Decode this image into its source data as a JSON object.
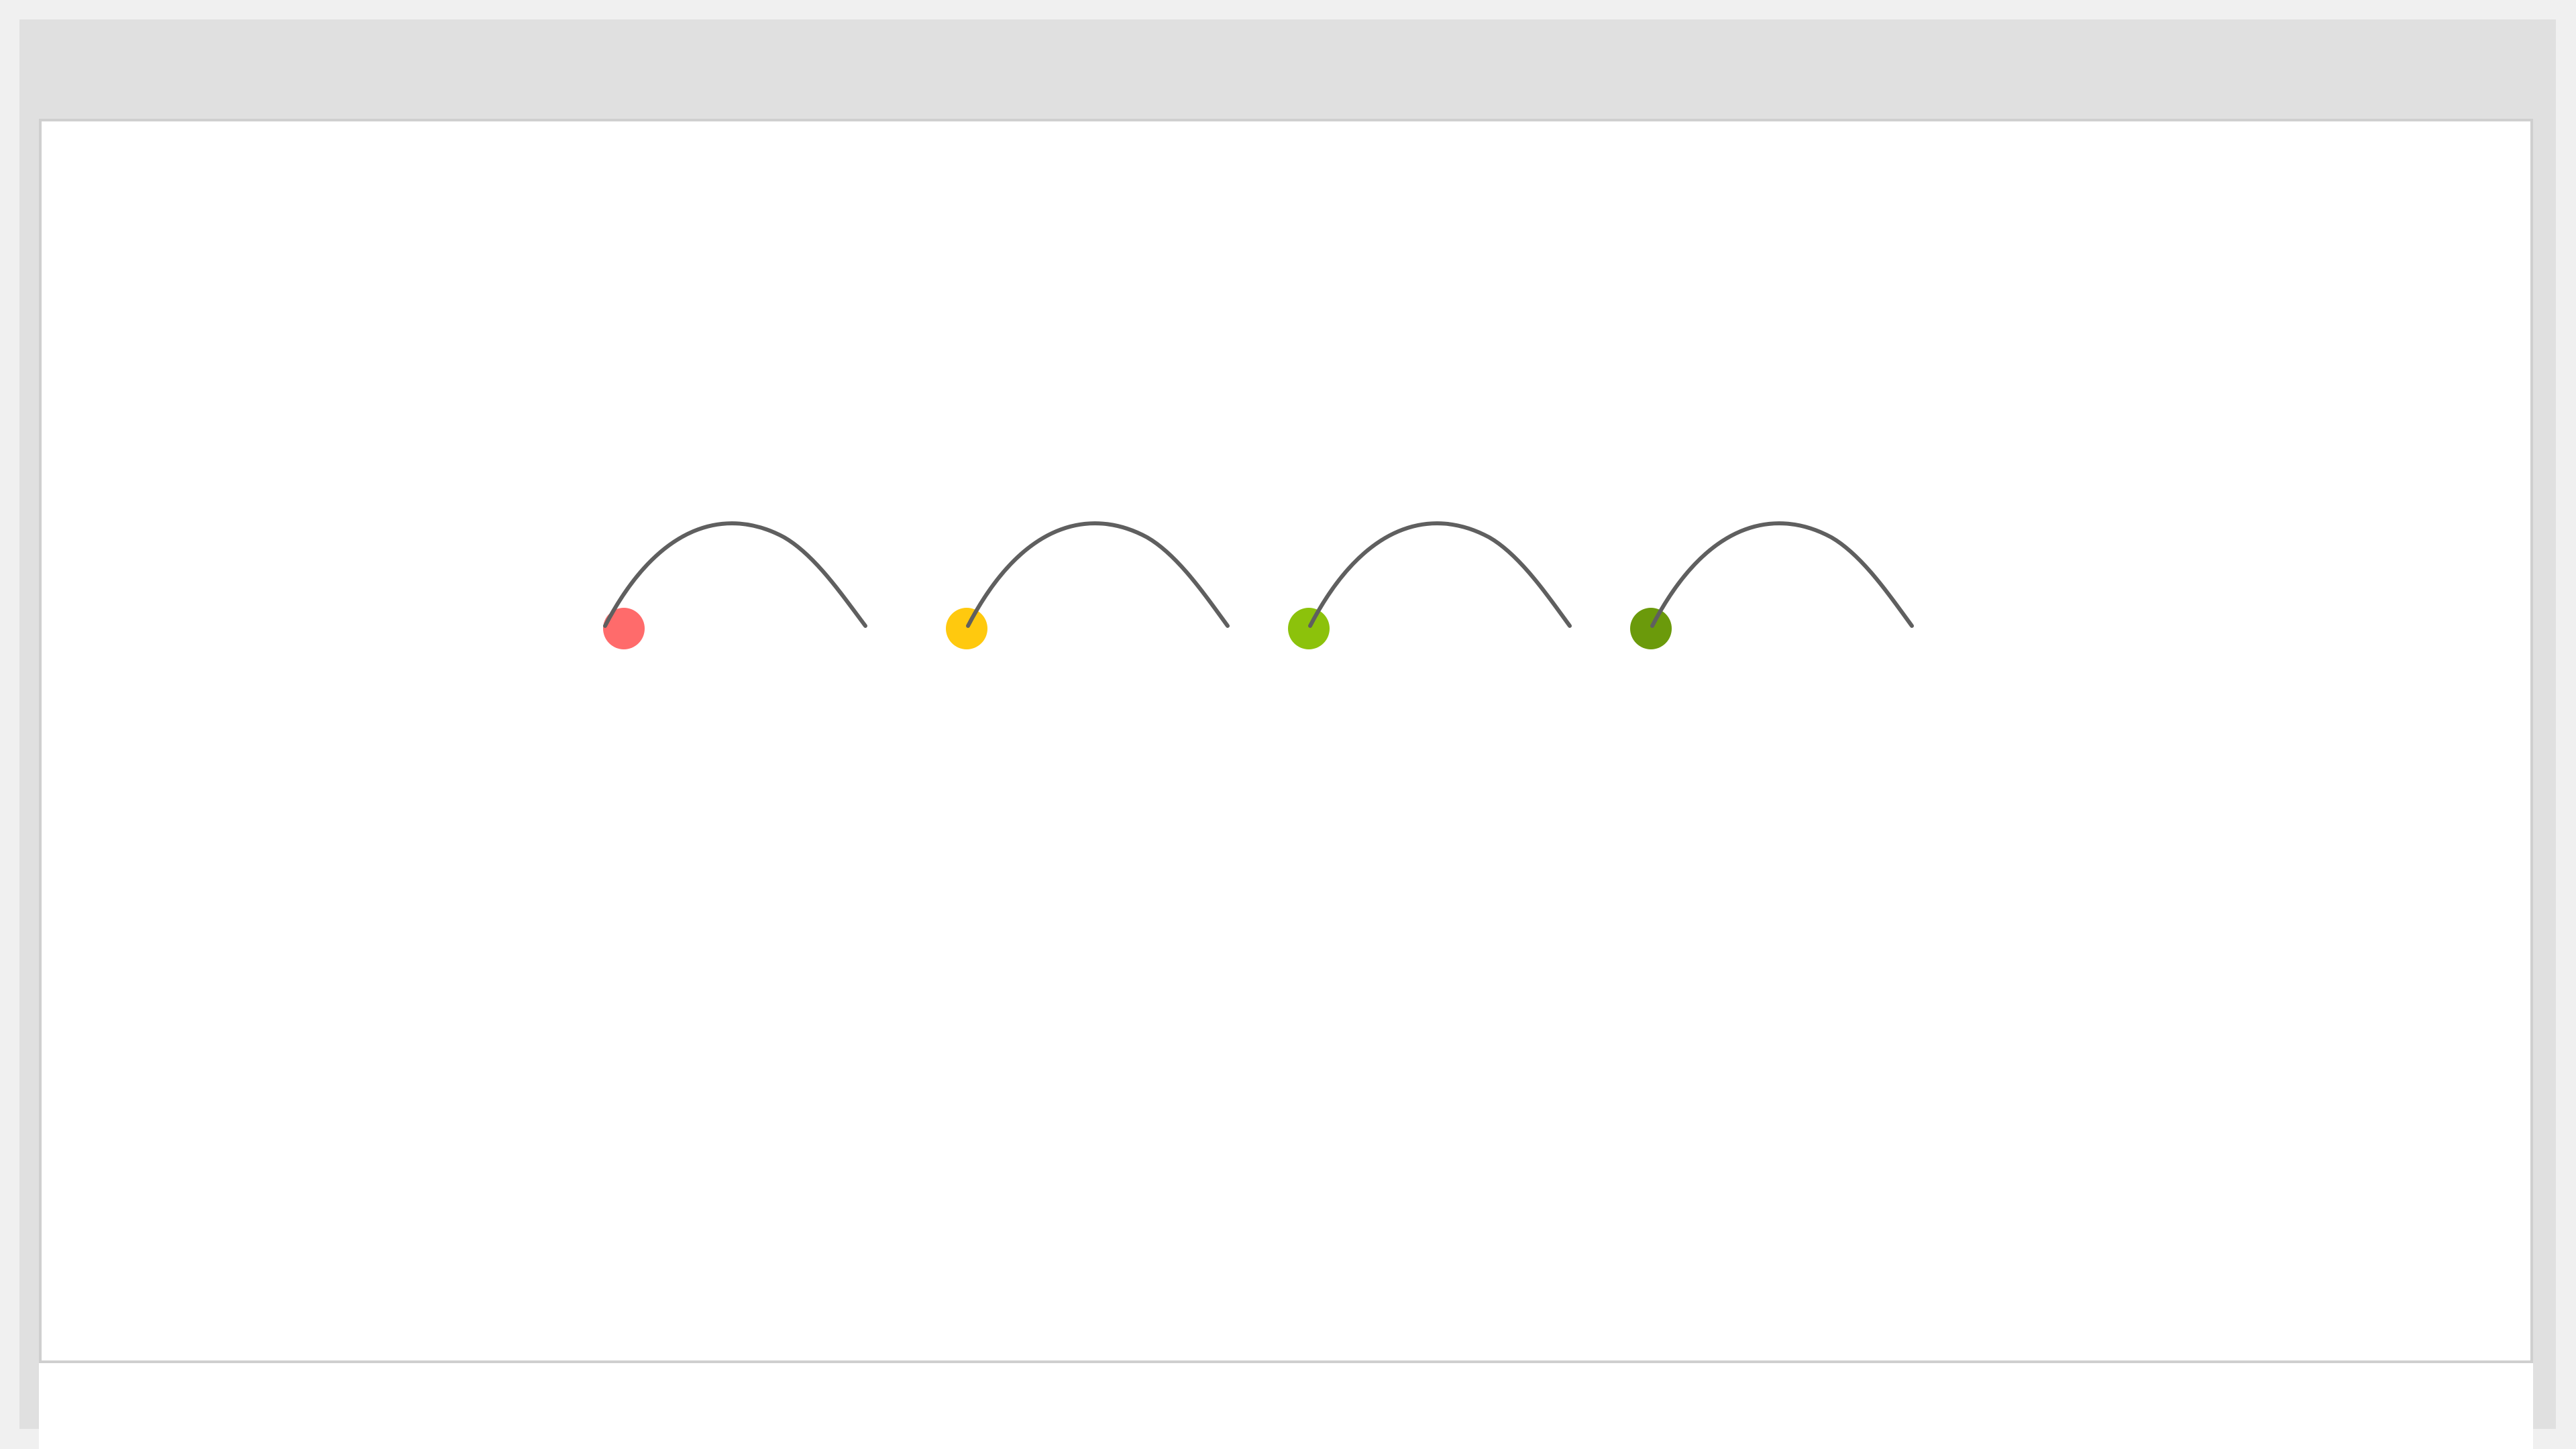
{
  "app": {
    "title": ""
  },
  "canvas": {
    "background": "#ffffff",
    "border_color": "#cfcfcf"
  },
  "arcs": {
    "stroke_color": "#5f5f5f",
    "items": [
      {
        "dot_color": "#ff6b6b"
      },
      {
        "dot_color": "#ffc90e"
      },
      {
        "dot_color": "#8cc20b"
      },
      {
        "dot_color": "#6b9a0b"
      }
    ]
  }
}
